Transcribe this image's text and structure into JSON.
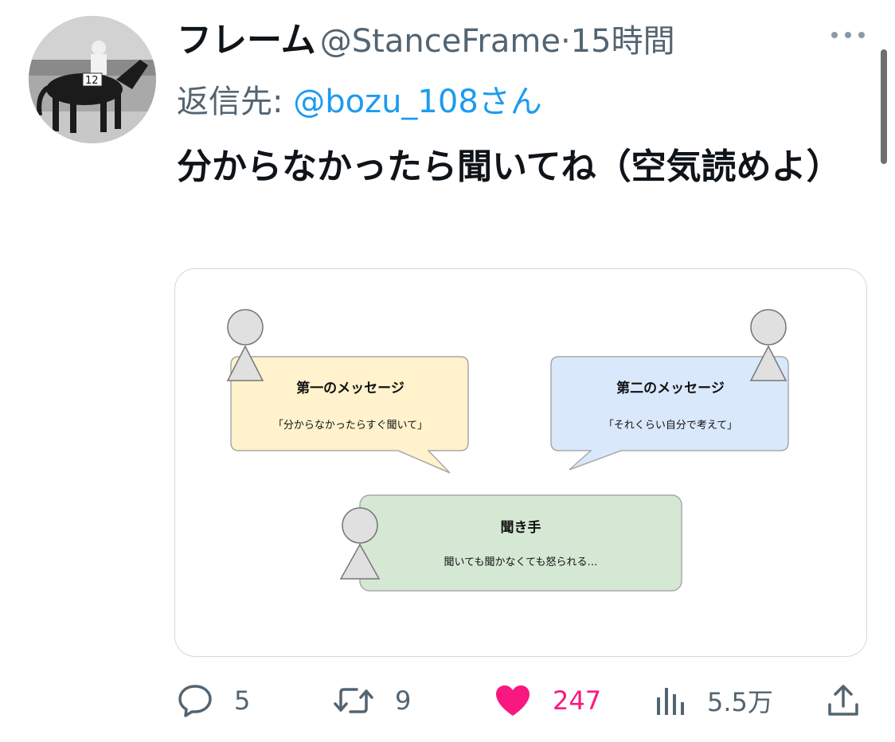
{
  "author": {
    "name": "フレーム",
    "handle": "@StanceFrame",
    "separator": "·",
    "time": "15時間",
    "avatar_number": "12"
  },
  "reply": {
    "prefix": "返信先: ",
    "handle": "@bozu_108さん"
  },
  "tweet": {
    "text": "分からなかったら聞いてね（空気読めよ）"
  },
  "media": {
    "bubble1": {
      "title": "第一のメッセージ",
      "body": "「分からなかったらすぐ聞いて」"
    },
    "bubble2": {
      "title": "第二のメッセージ",
      "body": "「それくらい自分で考えて」"
    },
    "bubble3": {
      "title": "聞き手",
      "body": "聞いても聞かなくても怒られる…"
    }
  },
  "actions": {
    "replies": "5",
    "retweets": "9",
    "likes": "247",
    "views": "5.5万"
  },
  "icons": {
    "reply": "speech-bubble-icon",
    "retweet": "retweet-arrows-icon",
    "like": "heart-icon",
    "views": "bar-chart-icon",
    "share": "share-upload-icon",
    "more": "ellipsis-icon"
  },
  "colors": {
    "like": "#f91880",
    "link": "#1d9bf0",
    "secondary_text": "#536471",
    "bubble1_fill": "#fff2cc",
    "bubble2_fill": "#dae8fc",
    "bubble3_fill": "#d5e8d4"
  }
}
